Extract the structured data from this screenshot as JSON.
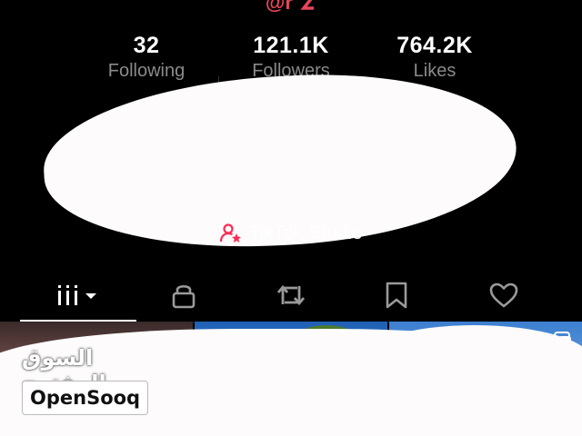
{
  "profile": {
    "username": "@r"
  },
  "stats": {
    "following": {
      "value": "32",
      "label": "Following"
    },
    "followers": {
      "value": "121.1K",
      "label": "Followers"
    },
    "likes": {
      "value": "764.2K",
      "label": "Likes"
    }
  },
  "studio": {
    "label": "TikTok Studio",
    "icon": "user-star-icon",
    "icon_color": "#fe2c55"
  },
  "tabs": [
    {
      "icon": "grid-icon",
      "selected": true
    },
    {
      "icon": "lock-icon",
      "selected": false
    },
    {
      "icon": "repost-icon",
      "selected": false
    },
    {
      "icon": "bookmark-icon",
      "selected": false
    },
    {
      "icon": "heart-outline-icon",
      "selected": false
    }
  ],
  "watermark": {
    "arabic": "السوق المفتوح",
    "latin": "OpenSooq"
  },
  "colors": {
    "background": "#000000",
    "username": "#e8455a",
    "accent": "#fe2c55",
    "secondary_text": "#8a8a8a"
  }
}
